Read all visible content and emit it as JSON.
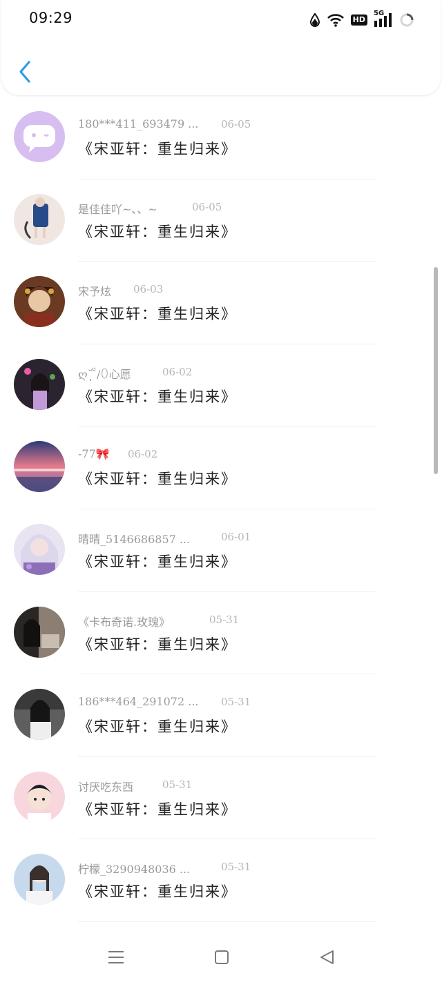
{
  "status_bar": {
    "time": "09:29",
    "icons": [
      "drop-icon",
      "wifi-icon",
      "hd-icon",
      "signal-5g-icon",
      "loading-ring-icon"
    ],
    "hd_label": "HD",
    "net_label": "5G"
  },
  "header": {
    "back_icon": "chevron-left-icon",
    "accent_color": "#2f9be6"
  },
  "list": {
    "items": [
      {
        "username": "180***411_693479 ...",
        "date": "06-05",
        "content": "《宋亚轩：重生归来》"
      },
      {
        "username": "是佳佳吖~、、~",
        "date": "06-05",
        "content": "《宋亚轩：重生归来》"
      },
      {
        "username": "宋予炫",
        "date": "06-03",
        "content": "《宋亚轩：重生归来》"
      },
      {
        "username": "ღ˘̩̩̩̩̩̩ ̆̈/ꄲ心愿",
        "date": "06-02",
        "content": "《宋亚轩：重生归来》"
      },
      {
        "username": "-77🎀",
        "date": "06-02",
        "content": "《宋亚轩：重生归来》"
      },
      {
        "username": "晴晴_5146686857 ...",
        "date": "06-01",
        "content": "《宋亚轩：重生归来》"
      },
      {
        "username": "《卡布奇诺.玫瑰》",
        "date": "05-31",
        "content": "《宋亚轩：重生归来》"
      },
      {
        "username": "186***464_291072 ...",
        "date": "05-31",
        "content": "《宋亚轩：重生归来》"
      },
      {
        "username": "讨厌吃东西",
        "date": "05-31",
        "content": "《宋亚轩：重生归来》"
      },
      {
        "username": "柠檬_3290948036 ...",
        "date": "05-31",
        "content": "《宋亚轩：重生归来》"
      }
    ]
  },
  "nav_bar": {
    "icons": [
      "menu-icon",
      "home-square-icon",
      "back-triangle-icon"
    ]
  }
}
